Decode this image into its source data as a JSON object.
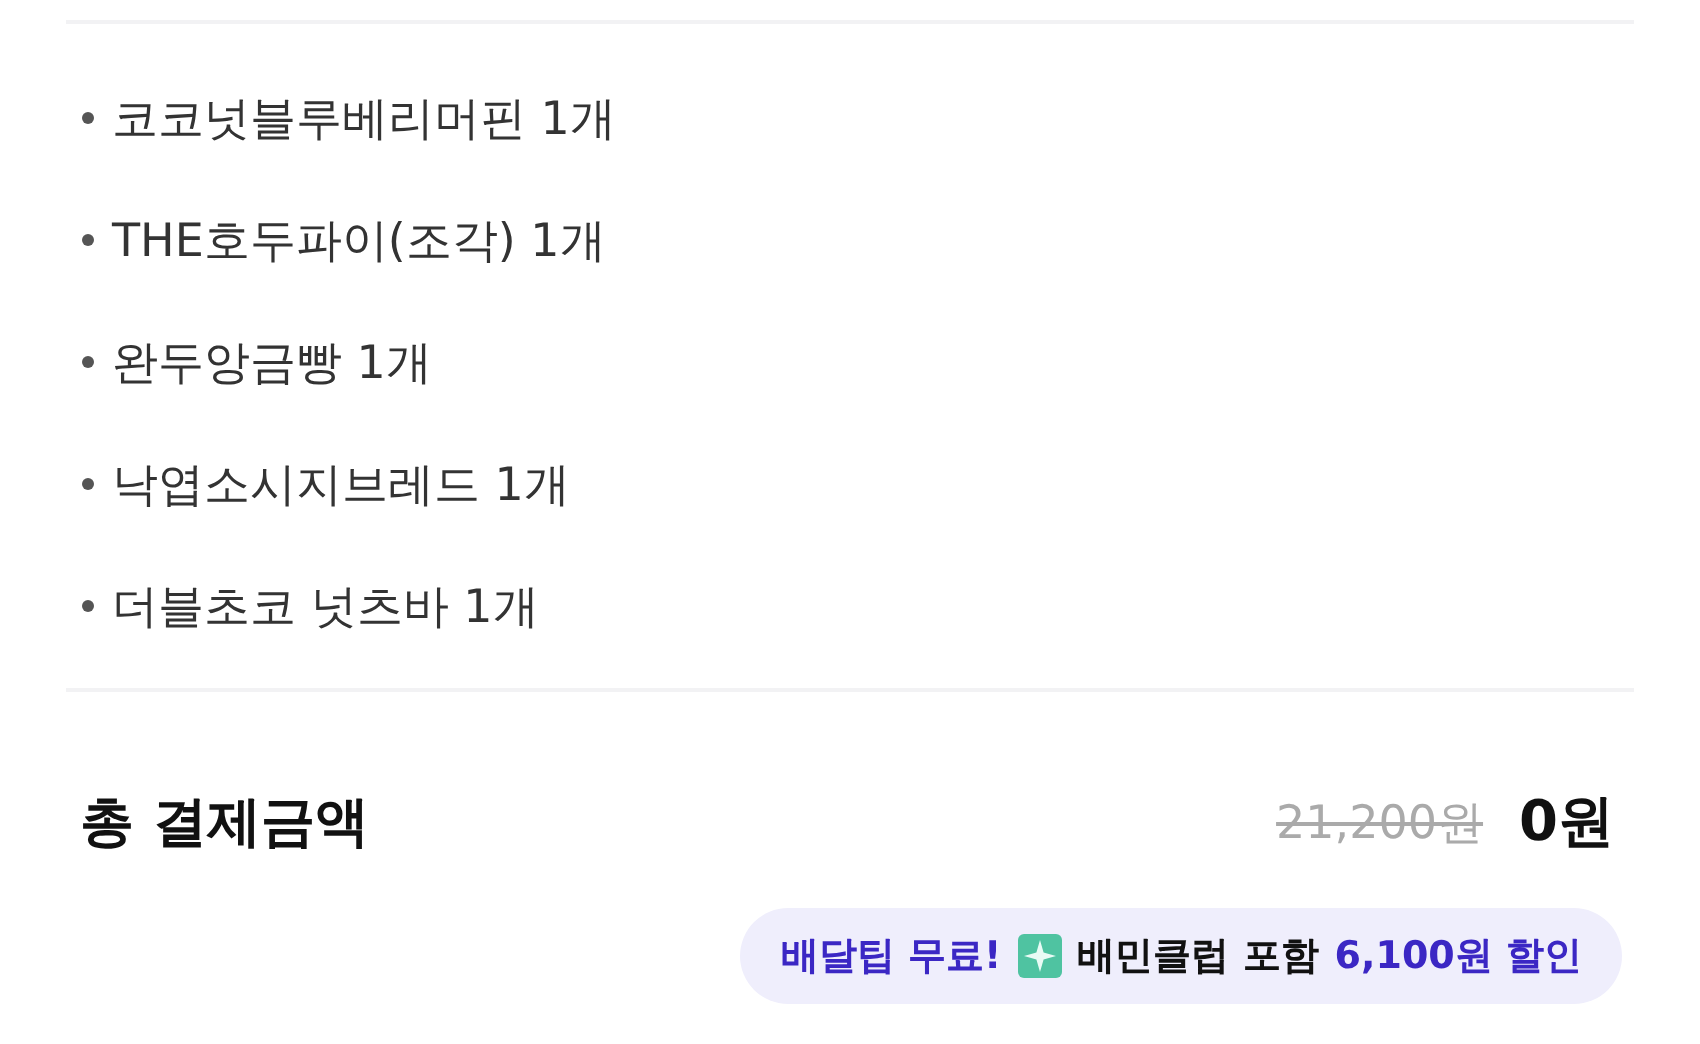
{
  "items": [
    {
      "name": "코코넛블루베리머핀 1개"
    },
    {
      "name": "THE호두파이(조각) 1개"
    },
    {
      "name": "완두앙금빵 1개"
    },
    {
      "name": "낙엽소시지브레드 1개"
    },
    {
      "name": "더블초코 넛츠바 1개"
    }
  ],
  "total": {
    "label": "총 결제금액",
    "original_price": "21,200원",
    "price": "0원"
  },
  "badge": {
    "lead": "배달팁 무료!",
    "club": "배민클럽 포함",
    "discount": "6,100원 할인"
  }
}
